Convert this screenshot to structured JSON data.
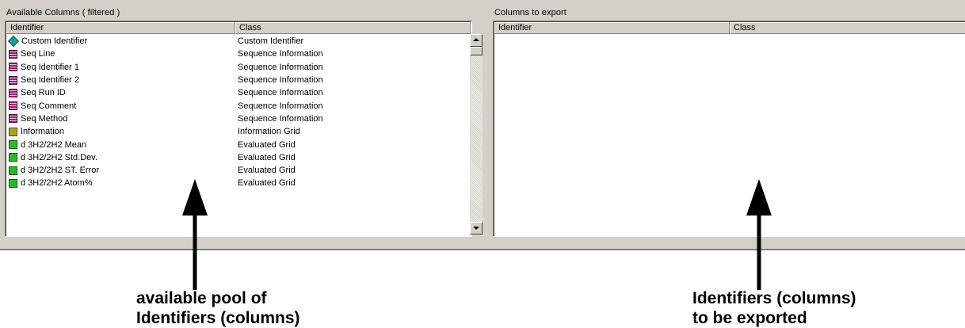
{
  "left_panel": {
    "title": "Available Columns ( filtered )",
    "columns": [
      "Identifier",
      "Class"
    ],
    "rows": [
      {
        "identifier": "Custom Identifier",
        "class": "Custom Identifier",
        "icon": "custom-identifier-diamond-icon"
      },
      {
        "identifier": "Seq Line",
        "class": "Sequence Information",
        "icon": "sequence-info-icon"
      },
      {
        "identifier": "Seq Identifier 1",
        "class": "Sequence Information",
        "icon": "sequence-info-icon"
      },
      {
        "identifier": "Seq Identifier 2",
        "class": "Sequence Information",
        "icon": "sequence-info-icon"
      },
      {
        "identifier": "Seq Run ID",
        "class": "Sequence Information",
        "icon": "sequence-info-icon"
      },
      {
        "identifier": "Seq Comment",
        "class": "Sequence Information",
        "icon": "sequence-info-icon"
      },
      {
        "identifier": "Seq Method",
        "class": "Sequence Information",
        "icon": "sequence-info-icon"
      },
      {
        "identifier": "Information",
        "class": "Information Grid",
        "icon": "information-grid-icon"
      },
      {
        "identifier": "d  3H2/2H2  Mean",
        "class": "Evaluated Grid",
        "icon": "evaluated-grid-icon"
      },
      {
        "identifier": "d  3H2/2H2  Std.Dev.",
        "class": "Evaluated Grid",
        "icon": "evaluated-grid-icon"
      },
      {
        "identifier": "d  3H2/2H2  ST. Error",
        "class": "Evaluated Grid",
        "icon": "evaluated-grid-icon"
      },
      {
        "identifier": "d  3H2/2H2 Atom%",
        "class": "Evaluated Grid",
        "icon": "evaluated-grid-icon"
      }
    ]
  },
  "right_panel": {
    "title": "Columns to export",
    "columns": [
      "Identifier",
      "Class"
    ],
    "rows": []
  },
  "annotations": {
    "left_caption": [
      "available pool of",
      "Identifiers (columns)"
    ],
    "right_caption": [
      "Identifiers (columns)",
      "to be exported"
    ]
  },
  "colors": {
    "window_background": "#d4d0c8",
    "custom_identifier_icon": "#1aa090",
    "sequence_info_icon": "#9b1f7a",
    "information_grid_icon": "#a3a332",
    "evaluated_grid_icon": "#2eb52e"
  }
}
